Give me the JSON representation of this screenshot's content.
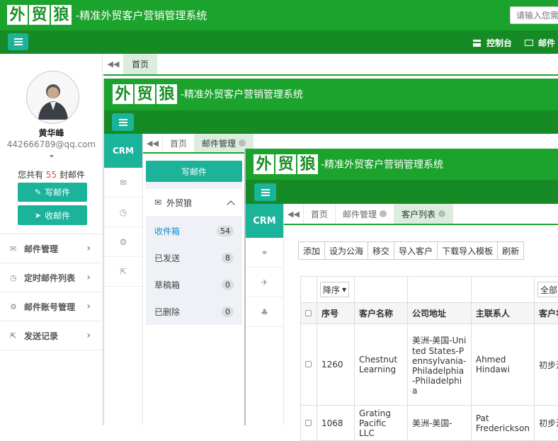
{
  "app": {
    "logo_chars": [
      "外",
      "贸",
      "狼"
    ],
    "title": "-精准外贸客户营销管理系统",
    "search_placeholder": "请输入您需"
  },
  "topbar": {
    "console": "控制台",
    "mail": "邮件"
  },
  "outer_tabs": [
    {
      "label": "首页"
    }
  ],
  "profile": {
    "name": "黄华峰",
    "email": "442666789@qq.com",
    "mail_count_prefix": "您共有",
    "mail_count": "55",
    "mail_count_suffix": "封邮件",
    "write_mail": "写邮件",
    "receive_mail": "收邮件"
  },
  "sidebar": {
    "items": [
      {
        "label": "邮件管理",
        "icon": "envelope-icon"
      },
      {
        "label": "定时邮件列表",
        "icon": "clock-icon"
      },
      {
        "label": "邮件账号管理",
        "icon": "gear-icon"
      },
      {
        "label": "发送记录",
        "icon": "share-icon"
      }
    ]
  },
  "frame2": {
    "crm": "CRM",
    "tabs": [
      {
        "label": "首页"
      },
      {
        "label": "邮件管理"
      }
    ],
    "write_mail": "写邮件",
    "account": "外贸狼",
    "folders": [
      {
        "label": "收件箱",
        "count": "54"
      },
      {
        "label": "已发送",
        "count": "8"
      },
      {
        "label": "草稿箱",
        "count": "0"
      },
      {
        "label": "已删除",
        "count": "0"
      }
    ]
  },
  "frame3": {
    "crm": "CRM",
    "tabs": [
      {
        "label": "首页"
      },
      {
        "label": "邮件管理"
      },
      {
        "label": "客户列表"
      }
    ],
    "toolbar": [
      "添加",
      "设为公海",
      "移交",
      "导入客户",
      "下载导入模板",
      "刷新"
    ],
    "filter": {
      "sort": "降序",
      "status": "全部"
    },
    "columns": [
      "序号",
      "客户名称",
      "公司地址",
      "主联系人",
      "客户状"
    ],
    "rows": [
      {
        "id": "1260",
        "name": "Chestnut Learning",
        "address": "美洲-美国-United States-Pennsylvania-Philadelphia-Philadelphia",
        "contact": "Ahmed Hindawi",
        "status": "初步沟"
      },
      {
        "id": "1068",
        "name": "Grating Pacific LLC",
        "address": "美洲-美国-",
        "contact": "Pat Frederickson",
        "status": "初步沟"
      }
    ]
  }
}
